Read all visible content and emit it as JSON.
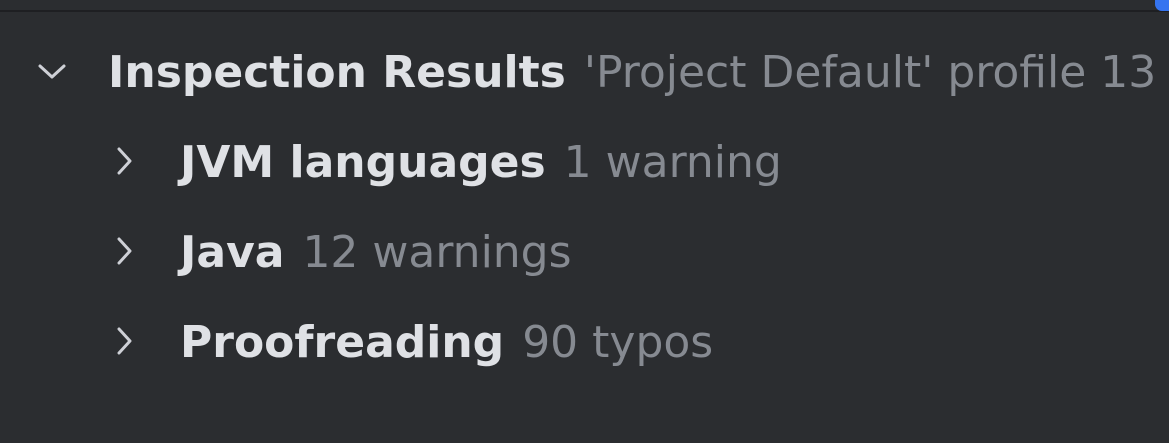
{
  "tree": {
    "root": {
      "label": "Inspection Results",
      "hint": "'Project Default' profile  13",
      "expanded": true,
      "icon": "chevron-down-icon"
    },
    "children": [
      {
        "label": "JVM languages",
        "hint": "1 warning",
        "expanded": false,
        "icon": "chevron-right-icon"
      },
      {
        "label": "Java",
        "hint": "12 warnings",
        "expanded": false,
        "icon": "chevron-right-icon"
      },
      {
        "label": "Proofreading",
        "hint": "90 typos",
        "expanded": false,
        "icon": "chevron-right-icon"
      }
    ]
  },
  "colors": {
    "background": "#2b2d30",
    "label": "#dfe1e5",
    "hint": "#868a91",
    "chevron": "#ced0d6",
    "accent": "#3574f0"
  }
}
